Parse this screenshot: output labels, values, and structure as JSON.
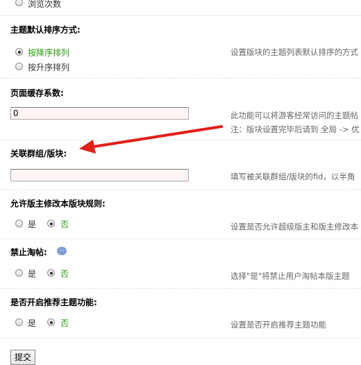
{
  "top_option": {
    "label": "浏览次数"
  },
  "sort_section": {
    "title": "主题默认排序方式:",
    "options": [
      "按降序排列",
      "按升序排列"
    ],
    "selected": 0,
    "desc": "设置版块的主题列表默认排序的方式"
  },
  "cache_section": {
    "title": "页面缓存系数:",
    "value": "0",
    "desc_line1": "此功能可以将游客经常访问的主题帖",
    "desc_line2": "注：版块设置完毕后请到 全局 -> 优"
  },
  "related_section": {
    "title": "关联群组/版块:",
    "value": "",
    "desc": "填写被关联群组/版块的fid，以半角"
  },
  "moderator_section": {
    "title": "允许版主修改本版块规则:",
    "yes": "是",
    "no": "否",
    "desc": "设置是否允许超级版主和版主修改本"
  },
  "ban_section": {
    "title": "禁止淘帖:",
    "yes": "是",
    "no": "否",
    "desc": "选择\"是\"将禁止用户淘帖本版主题"
  },
  "recommend_section": {
    "title": "是否开启推荐主题功能:",
    "yes": "是",
    "no": "否",
    "desc": "设置是否开启推荐主题功能"
  },
  "submit": {
    "label": "提交"
  },
  "colors": {
    "accent_green": "#2b9a10",
    "arrow_red": "#e0201b",
    "input_bg": "#fff5f5"
  }
}
